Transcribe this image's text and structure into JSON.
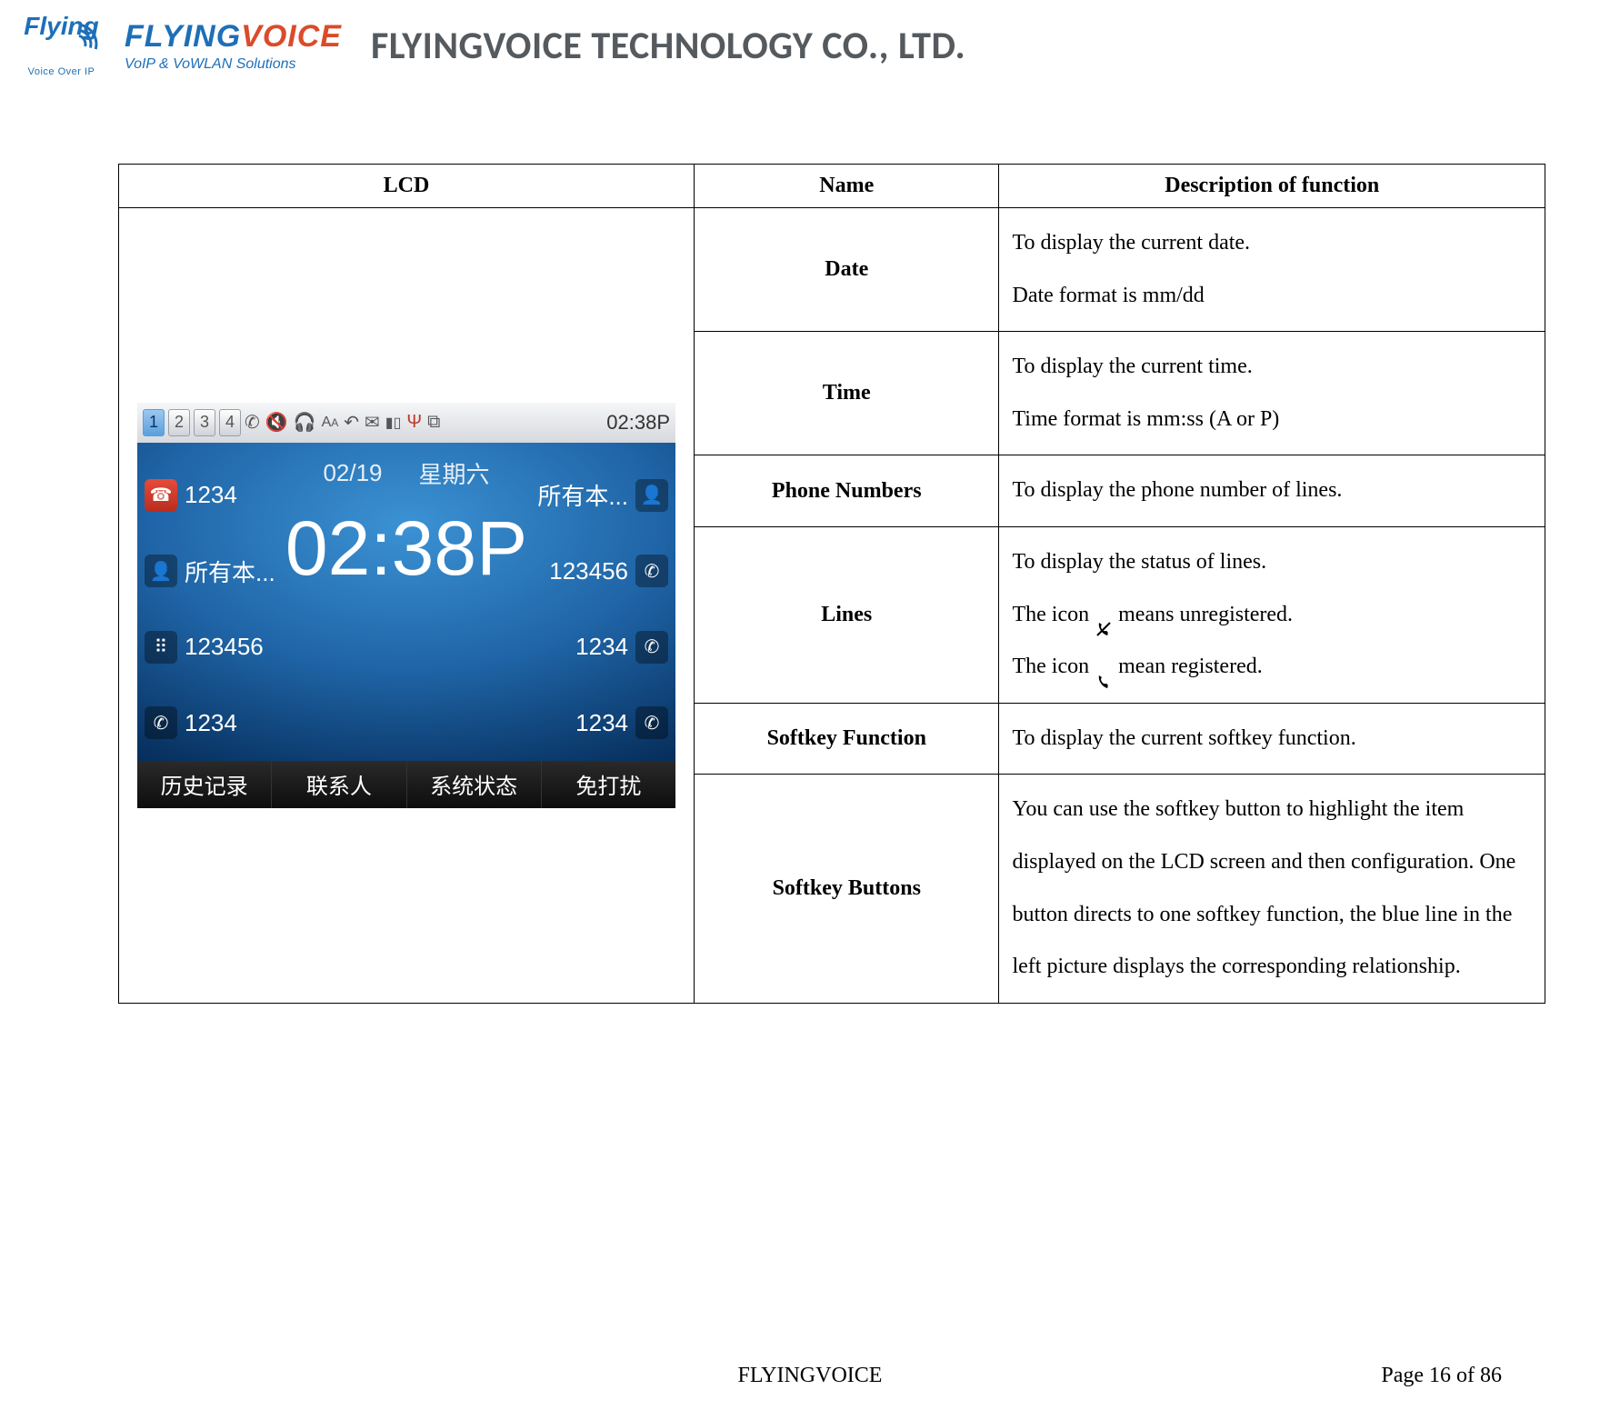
{
  "header": {
    "logo_square_text": "Flying",
    "logo_square_sub": "Voice Over IP",
    "logo_brand_1": "FLYING",
    "logo_brand_2": "VOICE",
    "logo_tag": "VoIP & VoWLAN Solutions",
    "company_title": "FLYINGVOICE TECHNOLOGY CO., LTD."
  },
  "table": {
    "headers": {
      "lcd": "LCD",
      "name": "Name",
      "desc": "Description of function"
    },
    "rows": [
      {
        "name": "Date",
        "desc": "To display the current date.\nDate format is mm/dd"
      },
      {
        "name": "Time",
        "desc": "To display the current time.\nTime format is mm:ss (A or P)"
      },
      {
        "name": "Phone Numbers",
        "desc": "To display the phone number of lines."
      },
      {
        "name": "Lines",
        "desc_before": "To display the status of lines.\nThe icon ",
        "desc_mid": " means unregistered.\nThe icon ",
        "desc_after": " mean registered."
      },
      {
        "name": "Softkey Function",
        "desc": "To display the current softkey function."
      },
      {
        "name": "Softkey Buttons",
        "desc": "You can use the softkey button to highlight the item displayed on the LCD screen and then configuration. One button directs to one softkey function, the blue line in the left picture displays the corresponding relationship."
      }
    ]
  },
  "lcd": {
    "tabs": [
      "1",
      "2",
      "3",
      "4"
    ],
    "status_time": "02:38P",
    "date": "02/19",
    "weekday": "星期六",
    "big_time": "02:38P",
    "left_lines": [
      {
        "label": "1234",
        "active": true,
        "icon": "phone"
      },
      {
        "label": "所有本...",
        "icon": "person"
      },
      {
        "label": "123456",
        "icon": "dialpad"
      },
      {
        "label": "1234",
        "icon": "call"
      }
    ],
    "right_lines": [
      {
        "label": "所有本...",
        "icon": "person-card"
      },
      {
        "label": "123456",
        "icon": "call"
      },
      {
        "label": "1234",
        "icon": "call"
      },
      {
        "label": "1234",
        "icon": "call"
      }
    ],
    "softkeys": [
      "历史记录",
      "联系人",
      "系统状态",
      "免打扰"
    ]
  },
  "footer": {
    "center": "FLYINGVOICE",
    "right": "Page  16  of  86"
  }
}
